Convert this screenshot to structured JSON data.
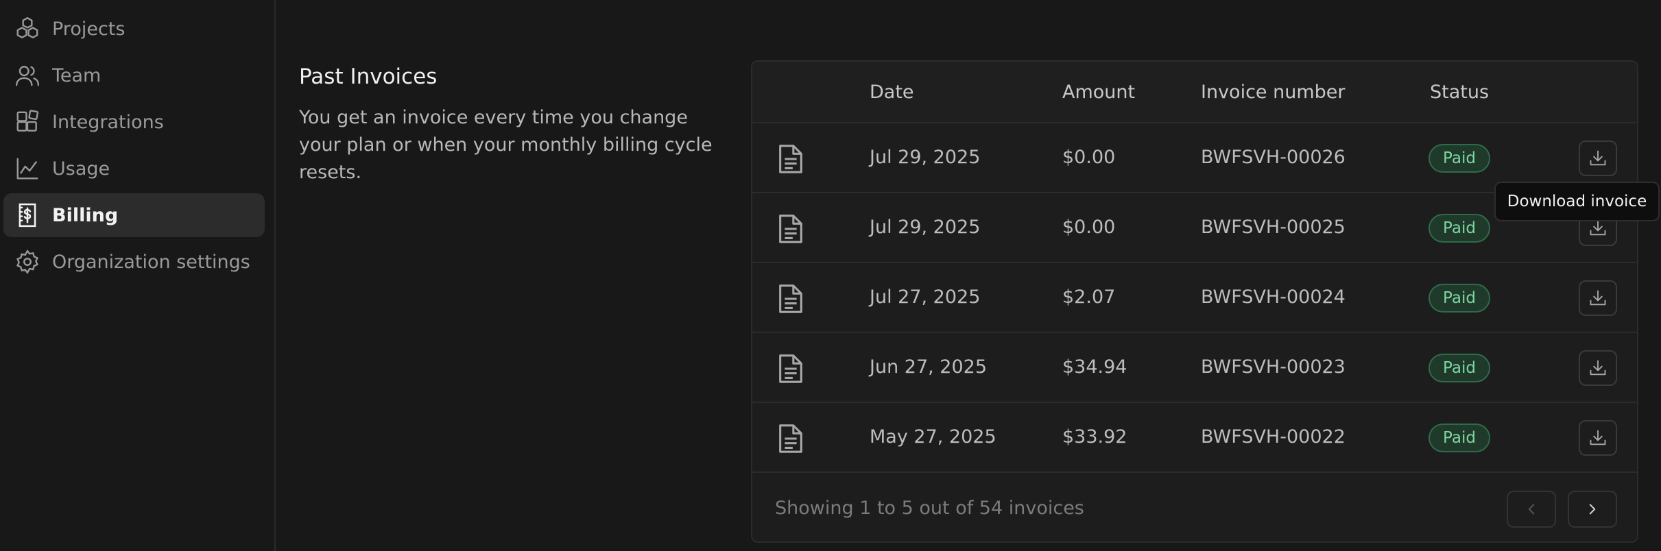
{
  "sidebar": {
    "items": [
      {
        "label": "Projects",
        "icon": "cubes-icon"
      },
      {
        "label": "Team",
        "icon": "users-icon"
      },
      {
        "label": "Integrations",
        "icon": "grid-plus-icon"
      },
      {
        "label": "Usage",
        "icon": "chart-line-icon"
      },
      {
        "label": "Billing",
        "icon": "receipt-dollar-icon",
        "active": true
      },
      {
        "label": "Organization settings",
        "icon": "gear-icon"
      }
    ]
  },
  "section": {
    "title": "Past Invoices",
    "description": "You get an invoice every time you change your plan or when your monthly billing cycle resets."
  },
  "table": {
    "headers": {
      "date": "Date",
      "amount": "Amount",
      "invoice_number": "Invoice number",
      "status": "Status"
    },
    "rows": [
      {
        "date": "Jul 29, 2025",
        "amount": "$0.00",
        "invoice_number": "BWFSVH-00026",
        "status": "Paid"
      },
      {
        "date": "Jul 29, 2025",
        "amount": "$0.00",
        "invoice_number": "BWFSVH-00025",
        "status": "Paid"
      },
      {
        "date": "Jul 27, 2025",
        "amount": "$2.07",
        "invoice_number": "BWFSVH-00024",
        "status": "Paid"
      },
      {
        "date": "Jun 27, 2025",
        "amount": "$34.94",
        "invoice_number": "BWFSVH-00023",
        "status": "Paid"
      },
      {
        "date": "May 27, 2025",
        "amount": "$33.92",
        "invoice_number": "BWFSVH-00022",
        "status": "Paid"
      }
    ],
    "footer_text": "Showing 1 to 5 out of 54 invoices"
  },
  "tooltip": {
    "text": "Download invoice"
  },
  "colors": {
    "accent_paid_text": "#7fd6a0",
    "accent_paid_bg": "#1f3a2b",
    "background": "#181818"
  }
}
